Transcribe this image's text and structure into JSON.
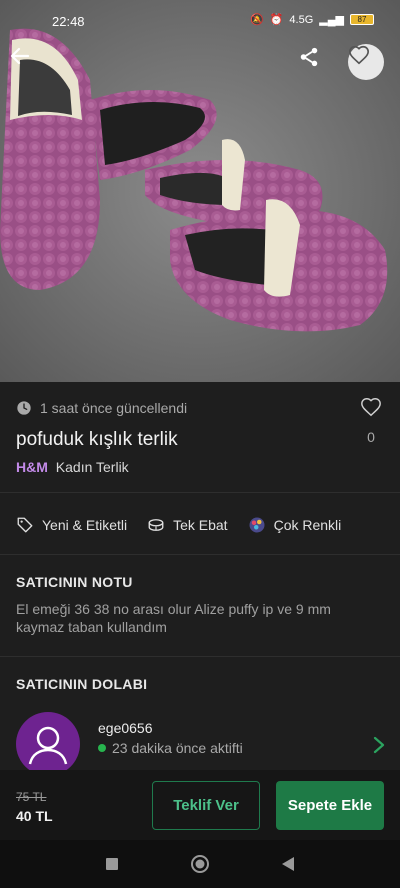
{
  "status_bar": {
    "time": "22:48",
    "network": "4.5G",
    "battery": "87"
  },
  "hero": {
    "back_icon": "back-arrow-icon",
    "share_icon": "share-icon",
    "favorite_icon": "heart-icon"
  },
  "product": {
    "updated": "1 saat önce güncellendi",
    "title": "pofuduk kışlık terlik",
    "brand": "H&M",
    "category": "Kadın Terlik",
    "likes": "0"
  },
  "attributes": [
    {
      "icon": "tag-icon",
      "label": "Yeni & Etiketli"
    },
    {
      "icon": "size-icon",
      "label": "Tek Ebat"
    },
    {
      "icon": "color-palette-icon",
      "label": "Çok Renkli"
    }
  ],
  "seller_note": {
    "title": "SATICININ NOTU",
    "text": "El emeği 36 38 no arası olur Alize puffy ip ve 9 mm kaymaz taban kullandım"
  },
  "seller_closet": {
    "title": "SATICININ DOLABI",
    "username": "ege0656",
    "status": "23 dakika önce aktifti"
  },
  "bottom": {
    "old_price": "75 TL",
    "price": "40 TL",
    "offer_label": "Teklif Ver",
    "cart_label": "Sepete Ekle"
  },
  "colors": {
    "accent_green": "#1e7a46",
    "brand_purple": "#c28ae8",
    "avatar_bg": "#6e2390"
  }
}
